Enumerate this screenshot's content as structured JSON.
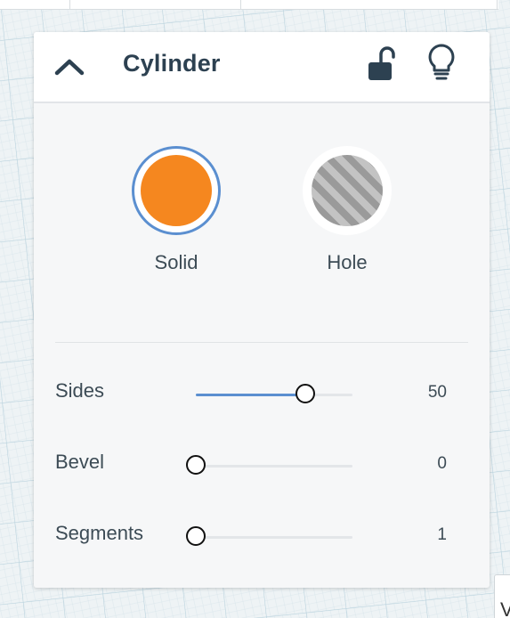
{
  "panel": {
    "title": "Cylinder"
  },
  "header_icons": {
    "collapse": "chevron-up-icon",
    "lock": "unlock-icon",
    "hint": "lightbulb-icon"
  },
  "shape_type": {
    "selected": "solid",
    "options": [
      {
        "id": "solid",
        "label": "Solid",
        "color": "#f5871f"
      },
      {
        "id": "hole",
        "label": "Hole",
        "pattern": "gray-diagonal-stripes"
      }
    ]
  },
  "sliders": [
    {
      "id": "sides",
      "label": "Sides",
      "value": "50",
      "fraction": 0.7
    },
    {
      "id": "bevel",
      "label": "Bevel",
      "value": "0",
      "fraction": 0
    },
    {
      "id": "segments",
      "label": "Segments",
      "value": "1",
      "fraction": 0
    }
  ],
  "colors": {
    "accent": "#5b8fd0",
    "solid_orange": "#f5871f",
    "title_text": "#2d4151"
  }
}
